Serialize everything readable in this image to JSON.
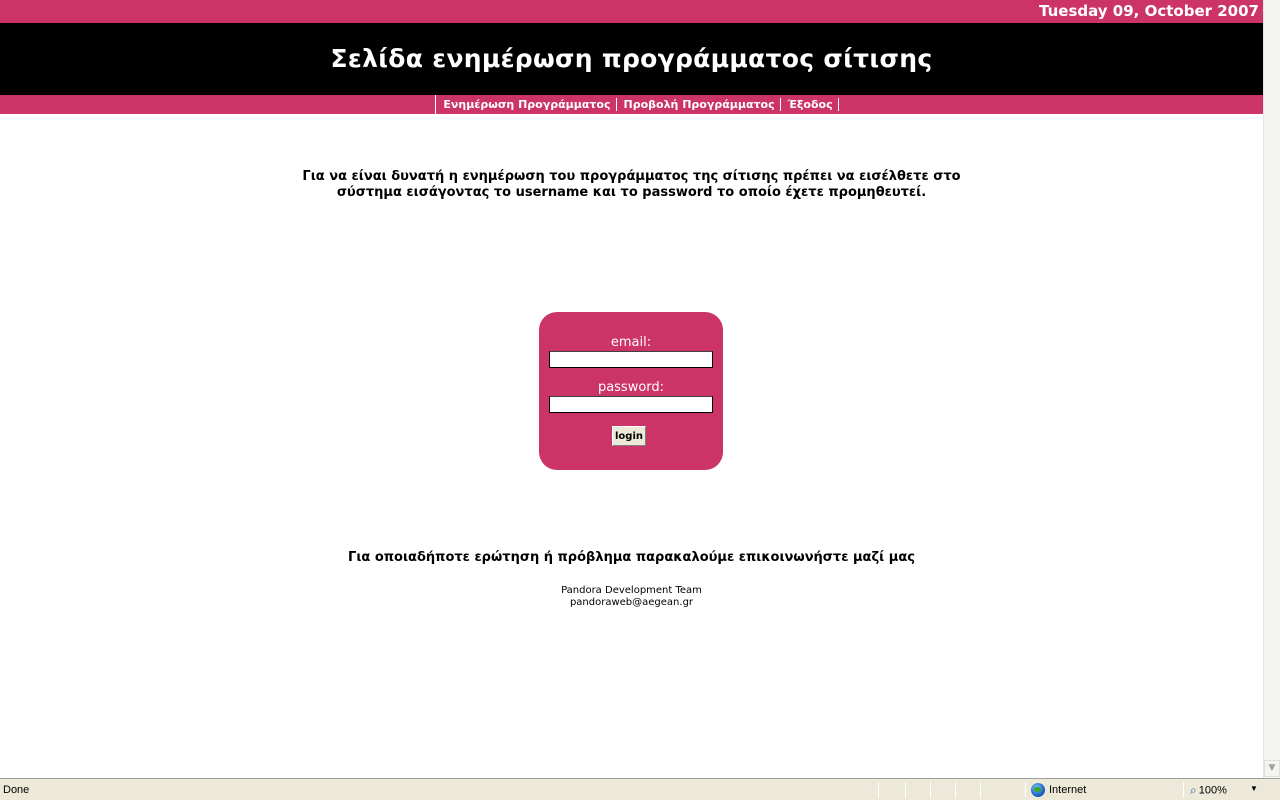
{
  "header": {
    "date": "Tuesday 09, October 2007",
    "title": "Σελίδα ενημέρωση προγράμματος σίτισης"
  },
  "nav": {
    "items": [
      {
        "label": "Ενημέρωση Προγράμματος"
      },
      {
        "label": "Προβολή Προγράμματος"
      },
      {
        "label": "Έξοδος"
      }
    ]
  },
  "intro": {
    "text": "Για να είναι δυνατή η ενημέρωση του προγράμματος της σίτισης πρέπει να εισέλθετε στο σύστημα εισάγοντας το username και το password το οποίο έχετε προμηθευτεί."
  },
  "login": {
    "email_label": "email:",
    "email_value": "",
    "password_label": "password:",
    "password_value": "",
    "button_label": "login"
  },
  "contact": {
    "text": "Για οποιαδήποτε ερώτηση ή πρόβλημα παρακαλούμε επικοινωνήστε μαζί μας",
    "team": "Pandora Development Team",
    "email": "pandoraweb@aegean.gr"
  },
  "statusbar": {
    "status": "Done",
    "zone": "Internet",
    "zoom": "100%",
    "zoom_icon": "magnifier-icon",
    "zone_icon": "globe-icon"
  },
  "colors": {
    "accent": "#cc3366",
    "header_bg": "#000000"
  }
}
